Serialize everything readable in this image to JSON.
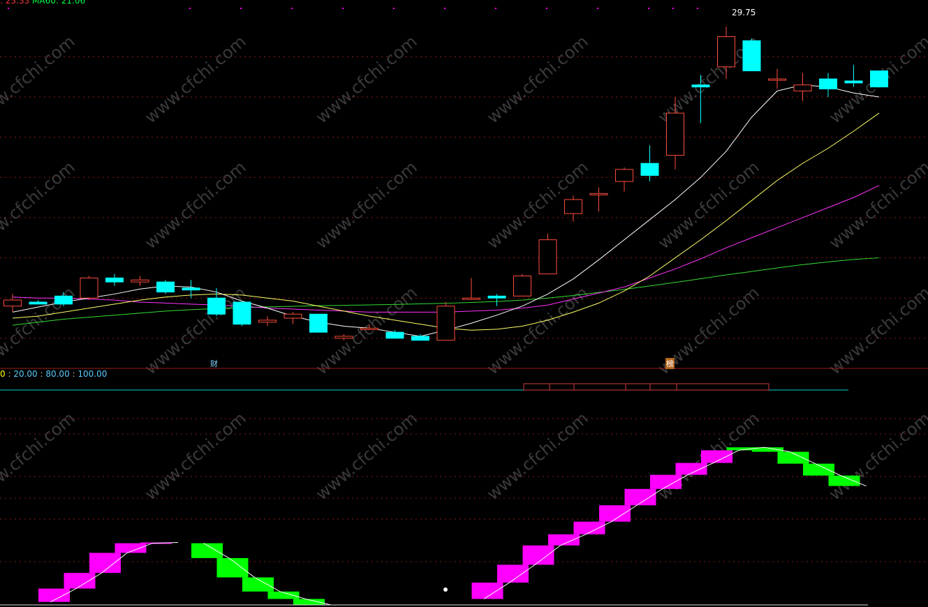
{
  "legend": {
    "ma5_text": ": 23.33",
    "ma60_text": "MA60: 21.06",
    "ind_v0": "0",
    "ind_v1": "20.00",
    "ind_v2": "80.00",
    "ind_v3": "100.00",
    "separator": " : "
  },
  "markers": {
    "cai": "财",
    "bang": "榜"
  },
  "colors": {
    "up": "#ff4c3b",
    "down": "#00ffff",
    "ma5": "#ffffff",
    "ma10": "#ffff66",
    "ma20": "#ff33ff",
    "ma60": "#33dd33",
    "rising_block": "#ff00ff",
    "falling_block": "#00ff00",
    "grid": "#8b1a1a"
  },
  "chart_data": [
    {
      "type": "candlestick",
      "high_label": "29.75",
      "x": [
        1,
        2,
        3,
        4,
        5,
        6,
        7,
        8,
        9,
        10,
        11,
        12,
        13,
        14,
        15,
        16,
        17,
        18,
        19,
        20,
        21,
        22,
        23,
        24,
        25,
        26,
        27,
        28,
        29,
        30,
        31,
        32,
        33,
        34,
        35
      ],
      "ohlc": [
        [
          15.6,
          16.2,
          15.3,
          15.9
        ],
        [
          15.8,
          15.9,
          15.7,
          15.7
        ],
        [
          16.1,
          16.3,
          15.6,
          15.7
        ],
        [
          16.0,
          17.1,
          15.9,
          17.0
        ],
        [
          17.0,
          17.2,
          16.6,
          16.8
        ],
        [
          16.8,
          17.1,
          16.6,
          16.9
        ],
        [
          16.8,
          16.9,
          16.2,
          16.3
        ],
        [
          16.5,
          16.9,
          16.0,
          16.4
        ],
        [
          16.0,
          16.5,
          15.1,
          15.2
        ],
        [
          15.8,
          15.8,
          14.6,
          14.7
        ],
        [
          14.8,
          15.1,
          14.6,
          14.9
        ],
        [
          15.0,
          15.3,
          14.7,
          15.2
        ],
        [
          15.2,
          15.2,
          14.3,
          14.3
        ],
        [
          14.0,
          14.2,
          13.9,
          14.1
        ],
        [
          14.5,
          14.7,
          14.4,
          14.5
        ],
        [
          14.3,
          14.4,
          14.1,
          14.0
        ],
        [
          14.1,
          14.2,
          13.9,
          13.9
        ],
        [
          13.9,
          15.8,
          13.9,
          15.6
        ],
        [
          16.0,
          17.0,
          15.9,
          16.0
        ],
        [
          16.1,
          16.2,
          15.6,
          16.0
        ],
        [
          16.1,
          17.2,
          16.1,
          17.1
        ],
        [
          17.2,
          19.2,
          17.2,
          18.9
        ],
        [
          20.2,
          21.1,
          19.8,
          20.9
        ],
        [
          21.2,
          21.5,
          20.3,
          21.2
        ],
        [
          21.8,
          22.5,
          21.3,
          22.4
        ],
        [
          22.7,
          23.6,
          21.8,
          22.1
        ],
        [
          23.1,
          26.0,
          22.4,
          25.2
        ],
        [
          26.6,
          27.1,
          24.7,
          26.5
        ],
        [
          27.5,
          29.5,
          26.9,
          29.0
        ],
        [
          28.8,
          28.9,
          27.3,
          27.3
        ],
        [
          26.9,
          27.4,
          26.4,
          26.9
        ],
        [
          26.3,
          27.2,
          25.8,
          26.6
        ],
        [
          26.9,
          27.2,
          26.0,
          26.4
        ],
        [
          26.8,
          27.6,
          26.5,
          26.7
        ],
        [
          27.3,
          27.1,
          26.8,
          26.5
        ]
      ],
      "ma5": [
        15.3,
        15.55,
        15.8,
        16.0,
        16.2,
        16.45,
        16.6,
        16.55,
        16.3,
        15.85,
        15.5,
        15.1,
        14.8,
        14.6,
        14.5,
        14.3,
        14.1,
        14.4,
        14.75,
        15.15,
        15.6,
        16.2,
        16.95,
        17.9,
        18.9,
        19.9,
        20.9,
        22.0,
        23.3,
        25.0,
        26.3,
        26.6,
        26.5,
        26.2,
        26.0
      ],
      "ma10": [
        15.0,
        15.1,
        15.3,
        15.5,
        15.7,
        15.9,
        16.05,
        16.15,
        16.2,
        16.15,
        16.0,
        15.85,
        15.6,
        15.35,
        15.1,
        14.9,
        14.7,
        14.5,
        14.4,
        14.45,
        14.6,
        14.9,
        15.3,
        15.75,
        16.35,
        17.1,
        18.0,
        18.9,
        19.85,
        20.85,
        21.85,
        22.7,
        23.45,
        24.3,
        25.2
      ],
      "ma20": [
        16.05,
        16.0,
        16.0,
        15.95,
        15.9,
        15.8,
        15.75,
        15.7,
        15.65,
        15.6,
        15.5,
        15.45,
        15.4,
        15.35,
        15.3,
        15.3,
        15.3,
        15.3,
        15.35,
        15.4,
        15.5,
        15.65,
        15.95,
        16.25,
        16.55,
        17.0,
        17.45,
        17.95,
        18.5,
        19.0,
        19.5,
        20.0,
        20.5,
        21.0,
        21.6
      ],
      "ma60": [
        14.65,
        14.8,
        14.95,
        15.05,
        15.15,
        15.25,
        15.35,
        15.42,
        15.48,
        15.52,
        15.56,
        15.59,
        15.62,
        15.64,
        15.66,
        15.68,
        15.71,
        15.74,
        15.78,
        15.83,
        15.9,
        16.0,
        16.13,
        16.28,
        16.43,
        16.6,
        16.78,
        16.96,
        17.15,
        17.32,
        17.5,
        17.66,
        17.8,
        17.92,
        18.0
      ],
      "y_ticks": [
        14,
        16,
        18,
        20,
        22,
        24,
        26,
        28
      ],
      "ylim": [
        13.3,
        30.2
      ]
    },
    {
      "type": "step-area",
      "title": "",
      "ylim": [
        0,
        100
      ],
      "reference_lines": [
        0,
        20,
        80,
        100
      ],
      "segments": [
        {
          "x": [
            2,
            3,
            4,
            5,
            6,
            7
          ],
          "values": [
            4,
            22,
            43,
            70,
            83,
            84
          ],
          "direction": "up"
        },
        {
          "x": [
            8,
            9,
            10,
            11,
            12,
            13
          ],
          "values": [
            83,
            63,
            37,
            18,
            8,
            0
          ],
          "direction": "down"
        },
        {
          "x": [
            19,
            20,
            21,
            22,
            23,
            24,
            25,
            26,
            27,
            28,
            29
          ],
          "values": [
            8,
            30,
            54,
            80,
            95,
            112,
            134,
            156,
            175,
            191,
            208
          ],
          "direction": "up"
        },
        {
          "x": [
            29,
            30,
            31,
            32,
            33,
            34
          ],
          "values": [
            208,
            212,
            206,
            190,
            174,
            160
          ],
          "direction": "down"
        }
      ]
    }
  ]
}
